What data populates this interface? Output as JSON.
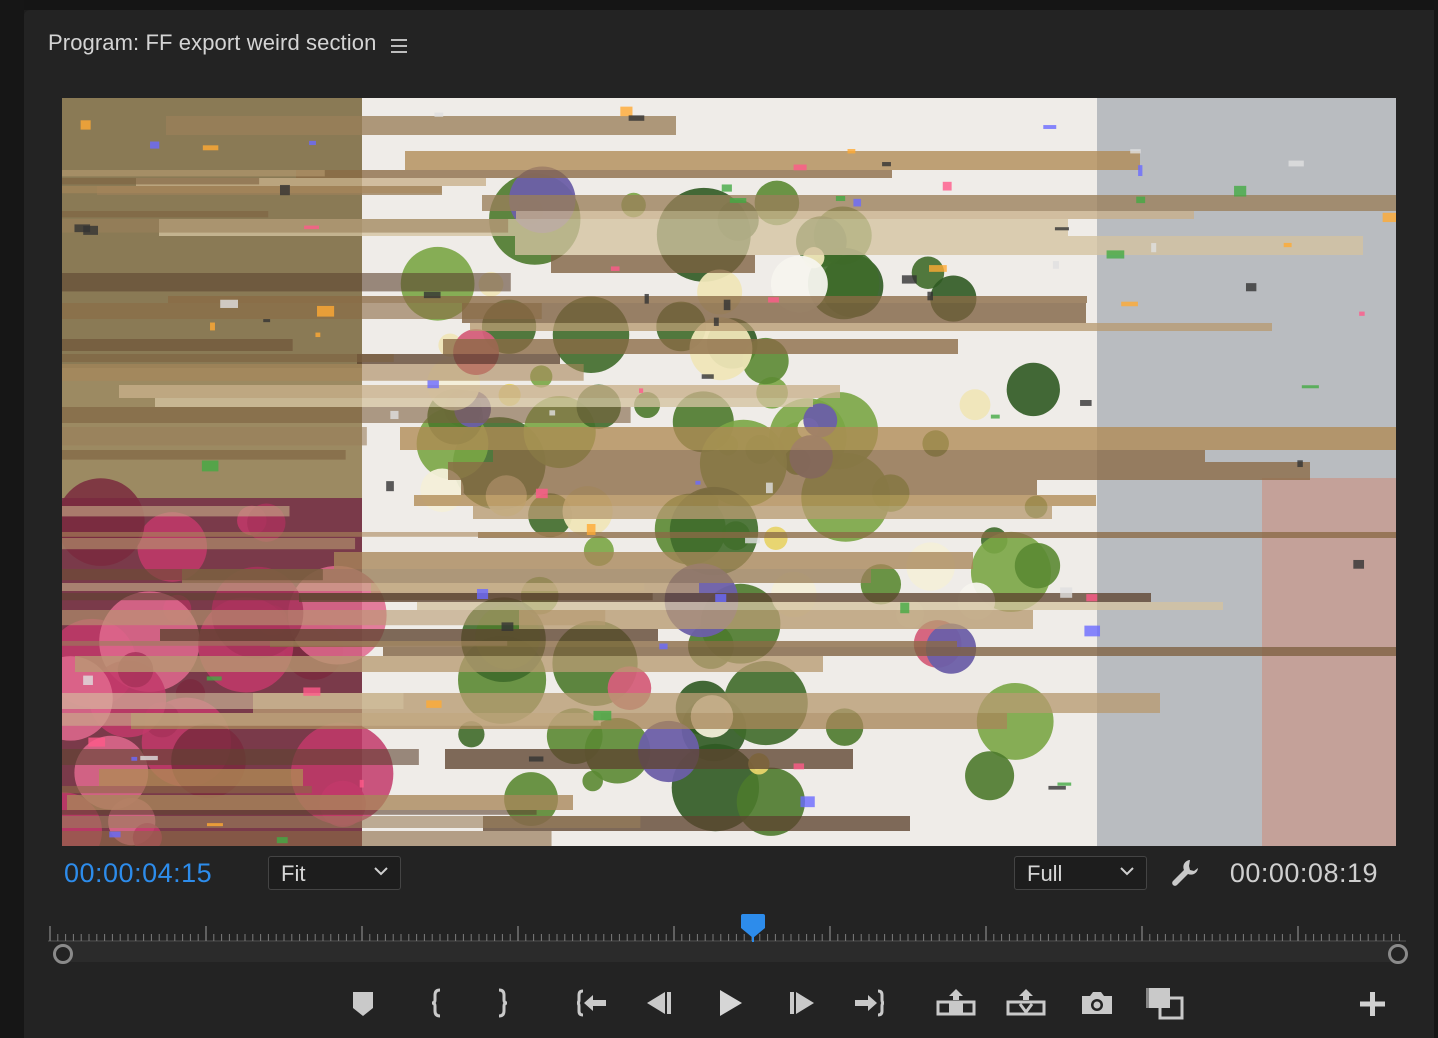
{
  "panel": {
    "title": "Program: FF export weird section",
    "menu_icon": "hamburger-menu-icon"
  },
  "timecode": {
    "current": "00:00:04:15",
    "duration": "00:00:08:19",
    "current_color": "#2d8ceb"
  },
  "zoom": {
    "selected": "Fit",
    "icon": "chevron-down-icon"
  },
  "resolution": {
    "selected": "Full",
    "icon": "chevron-down-icon"
  },
  "settings": {
    "icon": "wrench-icon"
  },
  "scrubber": {
    "playhead_color": "#2d8ceb"
  },
  "transport": {
    "buttons": [
      {
        "name": "add-marker-button",
        "icon": "marker-icon"
      },
      {
        "name": "mark-in-button",
        "icon": "brace-left-icon"
      },
      {
        "name": "mark-out-button",
        "icon": "brace-right-icon"
      },
      {
        "name": "go-to-in-button",
        "icon": "go-to-in-icon"
      },
      {
        "name": "step-back-button",
        "icon": "step-back-icon"
      },
      {
        "name": "play-button",
        "icon": "play-icon"
      },
      {
        "name": "step-forward-button",
        "icon": "step-forward-icon"
      },
      {
        "name": "go-to-out-button",
        "icon": "go-to-out-icon"
      },
      {
        "name": "lift-button",
        "icon": "lift-icon"
      },
      {
        "name": "extract-button",
        "icon": "extract-icon"
      },
      {
        "name": "export-frame-button",
        "icon": "camera-icon"
      },
      {
        "name": "comparison-view-button",
        "icon": "comparison-icon"
      },
      {
        "name": "button-editor-button",
        "icon": "plus-icon"
      }
    ]
  },
  "video": {
    "description_icon": "glitched-video-frame"
  }
}
